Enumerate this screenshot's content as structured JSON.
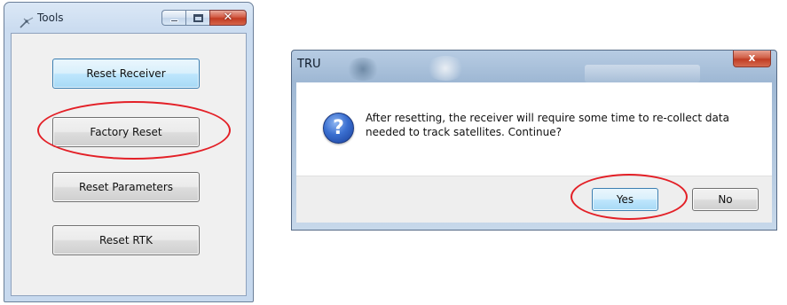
{
  "tools_window": {
    "title": "Tools",
    "buttons": [
      {
        "label": "Reset Receiver"
      },
      {
        "label": "Factory Reset"
      },
      {
        "label": "Reset Parameters"
      },
      {
        "label": "Reset RTK"
      }
    ]
  },
  "tru_dialog": {
    "title": "TRU",
    "close_glyph": "x",
    "message": "After resetting, the receiver will require some time to re-collect data needed to track satellites. Continue?",
    "buttons": {
      "yes": "Yes",
      "no": "No"
    }
  },
  "icons": {
    "tools_app": "satellite-icon",
    "dialog": "question-icon",
    "minimize": "minimize-icon",
    "maximize": "maximize-icon",
    "close": "close-icon"
  },
  "colors": {
    "highlight": "#e32027",
    "focus_border": "#3c7fb1",
    "titlebar": "#c7d9ee"
  }
}
